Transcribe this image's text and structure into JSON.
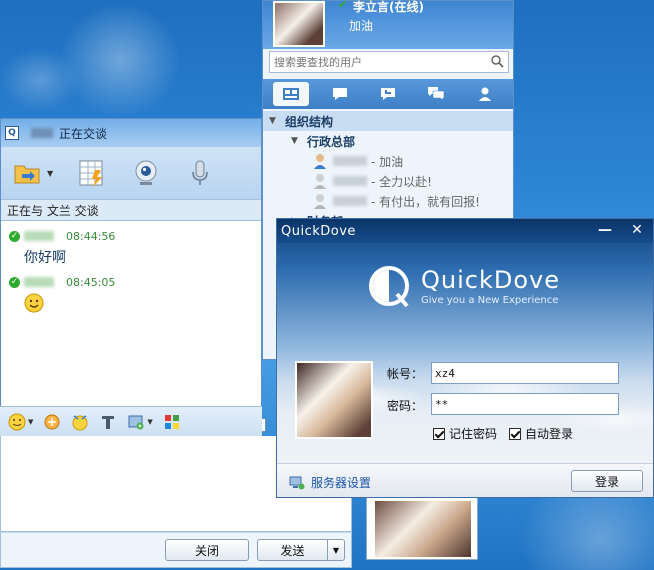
{
  "contact_window": {
    "username": "李立言(在线)",
    "signature": "加油",
    "search_placeholder": "搜索要查找的用户",
    "tree": {
      "section_label": "组织结构",
      "group_label": "行政总部",
      "members": [
        {
          "signature": "- 加油"
        },
        {
          "signature": "- 全力以赴!"
        },
        {
          "signature": "- 有付出，就有回报!"
        }
      ],
      "next_group_label": "财务部"
    }
  },
  "chat_window": {
    "title": "正在交谈",
    "subheader": "正在与 文兰 交谈",
    "messages": [
      {
        "time": "08:44:56",
        "text": "你好啊"
      },
      {
        "time": "08:45:05",
        "text": ""
      }
    ],
    "close_label": "关闭",
    "send_label": "发送"
  },
  "login_window": {
    "title": "QuickDove",
    "brand_name": "QuickDove",
    "slogan": "Give you a New Experience",
    "account_label": "帐号：",
    "account_value": "xz4",
    "password_label": "密码：",
    "password_value": "**",
    "remember_label": "记住密码",
    "autologin_label": "自动登录",
    "server_settings_label": "服务器设置",
    "login_label": "登录"
  }
}
